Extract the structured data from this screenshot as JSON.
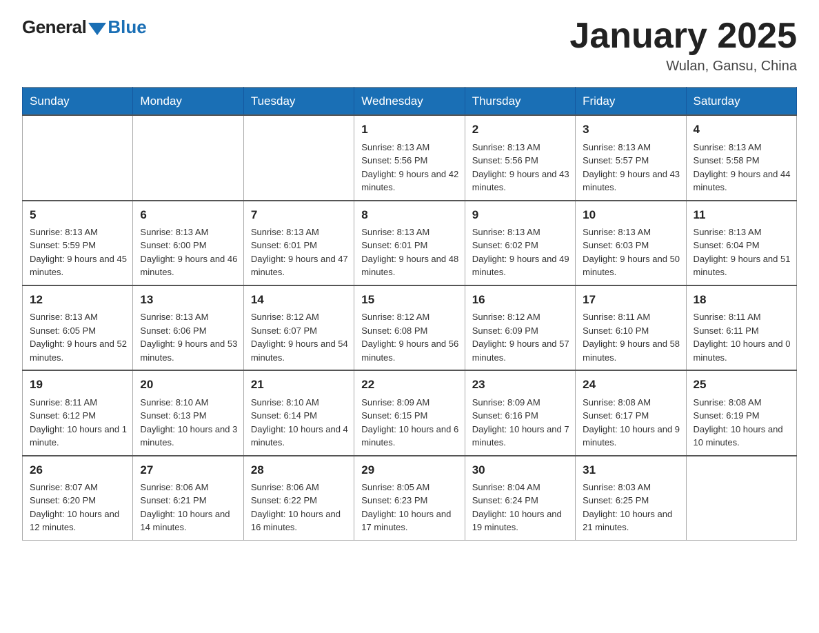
{
  "header": {
    "logo_general": "General",
    "logo_blue": "Blue",
    "month_year": "January 2025",
    "location": "Wulan, Gansu, China"
  },
  "days_of_week": [
    "Sunday",
    "Monday",
    "Tuesday",
    "Wednesday",
    "Thursday",
    "Friday",
    "Saturday"
  ],
  "weeks": [
    [
      {
        "day": "",
        "info": ""
      },
      {
        "day": "",
        "info": ""
      },
      {
        "day": "",
        "info": ""
      },
      {
        "day": "1",
        "info": "Sunrise: 8:13 AM\nSunset: 5:56 PM\nDaylight: 9 hours\nand 42 minutes."
      },
      {
        "day": "2",
        "info": "Sunrise: 8:13 AM\nSunset: 5:56 PM\nDaylight: 9 hours\nand 43 minutes."
      },
      {
        "day": "3",
        "info": "Sunrise: 8:13 AM\nSunset: 5:57 PM\nDaylight: 9 hours\nand 43 minutes."
      },
      {
        "day": "4",
        "info": "Sunrise: 8:13 AM\nSunset: 5:58 PM\nDaylight: 9 hours\nand 44 minutes."
      }
    ],
    [
      {
        "day": "5",
        "info": "Sunrise: 8:13 AM\nSunset: 5:59 PM\nDaylight: 9 hours\nand 45 minutes."
      },
      {
        "day": "6",
        "info": "Sunrise: 8:13 AM\nSunset: 6:00 PM\nDaylight: 9 hours\nand 46 minutes."
      },
      {
        "day": "7",
        "info": "Sunrise: 8:13 AM\nSunset: 6:01 PM\nDaylight: 9 hours\nand 47 minutes."
      },
      {
        "day": "8",
        "info": "Sunrise: 8:13 AM\nSunset: 6:01 PM\nDaylight: 9 hours\nand 48 minutes."
      },
      {
        "day": "9",
        "info": "Sunrise: 8:13 AM\nSunset: 6:02 PM\nDaylight: 9 hours\nand 49 minutes."
      },
      {
        "day": "10",
        "info": "Sunrise: 8:13 AM\nSunset: 6:03 PM\nDaylight: 9 hours\nand 50 minutes."
      },
      {
        "day": "11",
        "info": "Sunrise: 8:13 AM\nSunset: 6:04 PM\nDaylight: 9 hours\nand 51 minutes."
      }
    ],
    [
      {
        "day": "12",
        "info": "Sunrise: 8:13 AM\nSunset: 6:05 PM\nDaylight: 9 hours\nand 52 minutes."
      },
      {
        "day": "13",
        "info": "Sunrise: 8:13 AM\nSunset: 6:06 PM\nDaylight: 9 hours\nand 53 minutes."
      },
      {
        "day": "14",
        "info": "Sunrise: 8:12 AM\nSunset: 6:07 PM\nDaylight: 9 hours\nand 54 minutes."
      },
      {
        "day": "15",
        "info": "Sunrise: 8:12 AM\nSunset: 6:08 PM\nDaylight: 9 hours\nand 56 minutes."
      },
      {
        "day": "16",
        "info": "Sunrise: 8:12 AM\nSunset: 6:09 PM\nDaylight: 9 hours\nand 57 minutes."
      },
      {
        "day": "17",
        "info": "Sunrise: 8:11 AM\nSunset: 6:10 PM\nDaylight: 9 hours\nand 58 minutes."
      },
      {
        "day": "18",
        "info": "Sunrise: 8:11 AM\nSunset: 6:11 PM\nDaylight: 10 hours\nand 0 minutes."
      }
    ],
    [
      {
        "day": "19",
        "info": "Sunrise: 8:11 AM\nSunset: 6:12 PM\nDaylight: 10 hours\nand 1 minute."
      },
      {
        "day": "20",
        "info": "Sunrise: 8:10 AM\nSunset: 6:13 PM\nDaylight: 10 hours\nand 3 minutes."
      },
      {
        "day": "21",
        "info": "Sunrise: 8:10 AM\nSunset: 6:14 PM\nDaylight: 10 hours\nand 4 minutes."
      },
      {
        "day": "22",
        "info": "Sunrise: 8:09 AM\nSunset: 6:15 PM\nDaylight: 10 hours\nand 6 minutes."
      },
      {
        "day": "23",
        "info": "Sunrise: 8:09 AM\nSunset: 6:16 PM\nDaylight: 10 hours\nand 7 minutes."
      },
      {
        "day": "24",
        "info": "Sunrise: 8:08 AM\nSunset: 6:17 PM\nDaylight: 10 hours\nand 9 minutes."
      },
      {
        "day": "25",
        "info": "Sunrise: 8:08 AM\nSunset: 6:19 PM\nDaylight: 10 hours\nand 10 minutes."
      }
    ],
    [
      {
        "day": "26",
        "info": "Sunrise: 8:07 AM\nSunset: 6:20 PM\nDaylight: 10 hours\nand 12 minutes."
      },
      {
        "day": "27",
        "info": "Sunrise: 8:06 AM\nSunset: 6:21 PM\nDaylight: 10 hours\nand 14 minutes."
      },
      {
        "day": "28",
        "info": "Sunrise: 8:06 AM\nSunset: 6:22 PM\nDaylight: 10 hours\nand 16 minutes."
      },
      {
        "day": "29",
        "info": "Sunrise: 8:05 AM\nSunset: 6:23 PM\nDaylight: 10 hours\nand 17 minutes."
      },
      {
        "day": "30",
        "info": "Sunrise: 8:04 AM\nSunset: 6:24 PM\nDaylight: 10 hours\nand 19 minutes."
      },
      {
        "day": "31",
        "info": "Sunrise: 8:03 AM\nSunset: 6:25 PM\nDaylight: 10 hours\nand 21 minutes."
      },
      {
        "day": "",
        "info": ""
      }
    ]
  ]
}
